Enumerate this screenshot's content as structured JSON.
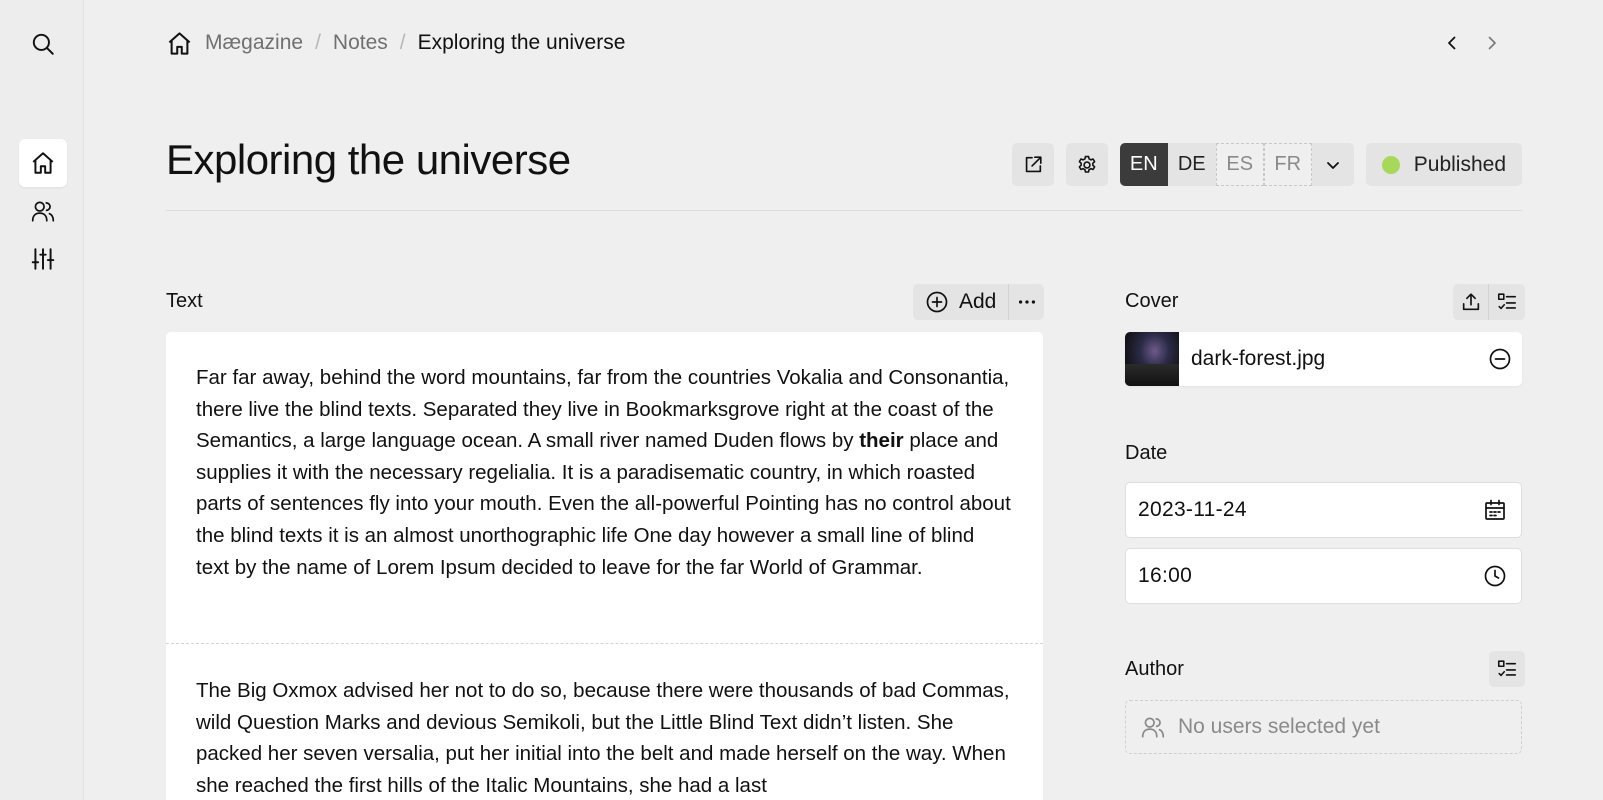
{
  "rail": {
    "items": [
      {
        "icon": "search-icon"
      },
      {
        "icon": "home-icon",
        "active": true
      },
      {
        "icon": "users-icon"
      },
      {
        "icon": "sliders-icon"
      }
    ]
  },
  "breadcrumb": {
    "items": [
      "Mægazine",
      "Notes"
    ],
    "separator": "/",
    "current": "Exploring the universe"
  },
  "page": {
    "title": "Exploring the universe"
  },
  "header": {
    "languages": [
      {
        "code": "EN",
        "state": "active"
      },
      {
        "code": "DE",
        "state": "normal"
      },
      {
        "code": "ES",
        "state": "untranslated"
      },
      {
        "code": "FR",
        "state": "untranslated"
      }
    ],
    "status": {
      "label": "Published",
      "color": "#a8d85a"
    }
  },
  "text_section": {
    "label": "Text",
    "add_label": "Add",
    "blocks": [
      {
        "before": "Far far away, behind the word mountains, far from the countries Vokalia and Consonantia, there live the blind texts. Separated they live in Bookmarksgrove right at the coast of the Semantics, a large language ocean. A small river named Duden flows by ",
        "bold": "their",
        "after": " place and supplies it with the necessary regelialia. It is a paradisematic country, in which roasted parts of sentences fly into your mouth. Even the all-powerful Pointing has no control about the blind texts it is an almost unorthographic life One day however a small line of blind text by the name of Lorem Ipsum decided to leave for the far World of Grammar."
      },
      {
        "text": "The Big Oxmox advised her not to do so, because there were thousands of bad Commas, wild Question Marks and devious Semikoli, but the Little Blind Text didn’t listen. She packed her seven versalia, put her initial into the belt and made herself on the way. When she reached the first hills of the Italic Mountains, she had a last"
      }
    ]
  },
  "cover": {
    "label": "Cover",
    "file": "dark-forest.jpg"
  },
  "date": {
    "label": "Date",
    "date_value": "2023-11-24",
    "time_value": "16:00"
  },
  "author": {
    "label": "Author",
    "empty_text": "No users selected yet"
  }
}
